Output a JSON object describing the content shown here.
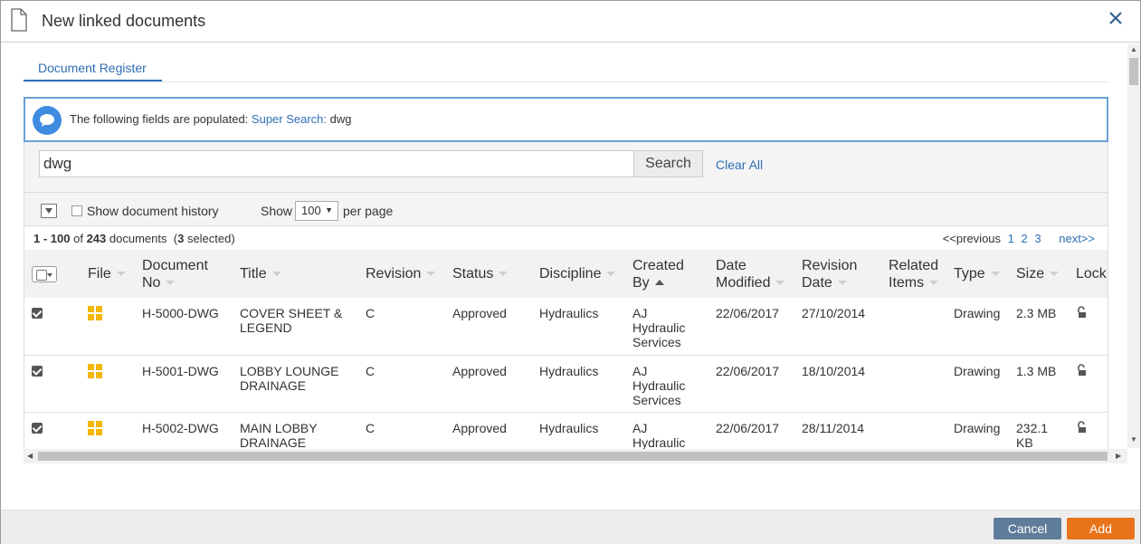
{
  "dialog": {
    "title": "New linked documents",
    "icons": {
      "doc": "document-icon",
      "close": "close-icon"
    }
  },
  "tabs": [
    {
      "label": "Document Register",
      "active": true
    }
  ],
  "notice": {
    "prefix": "The following fields are populated:",
    "field": "Super Search:",
    "value": "dwg"
  },
  "search": {
    "value": "dwg",
    "button": "Search",
    "clear": "Clear All"
  },
  "options": {
    "history_label": "Show document history",
    "show_label": "Show",
    "per_page_value": "100",
    "per_page_label": "per page"
  },
  "summary": {
    "range": "1 - 100",
    "of": "of",
    "total": "243",
    "documents": "documents",
    "selected_open": "(",
    "selected_count": "3",
    "selected_label": "selected)"
  },
  "pager": {
    "prev": "<<previous",
    "pages": [
      "1",
      "2",
      "3"
    ],
    "next": "next>>"
  },
  "table": {
    "columns": [
      {
        "key": "select",
        "label": ""
      },
      {
        "key": "file",
        "label": "File"
      },
      {
        "key": "docno",
        "label": "Document No"
      },
      {
        "key": "title",
        "label": "Title"
      },
      {
        "key": "revision",
        "label": "Revision"
      },
      {
        "key": "status",
        "label": "Status"
      },
      {
        "key": "discipline",
        "label": "Discipline"
      },
      {
        "key": "createdby",
        "label": "Created By"
      },
      {
        "key": "modified",
        "label": "Date Modified"
      },
      {
        "key": "revdate",
        "label": "Revision Date"
      },
      {
        "key": "related",
        "label": "Related Items"
      },
      {
        "key": "type",
        "label": "Type"
      },
      {
        "key": "size",
        "label": "Size"
      },
      {
        "key": "lock",
        "label": "Lock"
      }
    ],
    "rows": [
      {
        "docno": "H-5000-DWG",
        "title": "COVER SHEET & LEGEND",
        "revision": "C",
        "status": "Approved",
        "discipline": "Hydraulics",
        "createdby": "AJ Hydraulic Services",
        "modified": "22/06/2017",
        "revdate": "27/10/2014",
        "related": "",
        "type": "Drawing",
        "size": "2.3 MB"
      },
      {
        "docno": "H-5001-DWG",
        "title": "LOBBY LOUNGE DRAINAGE",
        "revision": "C",
        "status": "Approved",
        "discipline": "Hydraulics",
        "createdby": "AJ Hydraulic Services",
        "modified": "22/06/2017",
        "revdate": "18/10/2014",
        "related": "",
        "type": "Drawing",
        "size": "1.3 MB"
      },
      {
        "docno": "H-5002-DWG",
        "title": "MAIN LOBBY DRAINAGE",
        "revision": "C",
        "status": "Approved",
        "discipline": "Hydraulics",
        "createdby": "AJ Hydraulic",
        "modified": "22/06/2017",
        "revdate": "28/11/2014",
        "related": "",
        "type": "Drawing",
        "size": "232.1 KB"
      }
    ]
  },
  "footer": {
    "cancel": "Cancel",
    "add": "Add"
  },
  "colors": {
    "accent": "#2e6fb5",
    "add": "#e8731a",
    "cancel": "#5f7d9b",
    "file_icon": "#f2b705"
  }
}
